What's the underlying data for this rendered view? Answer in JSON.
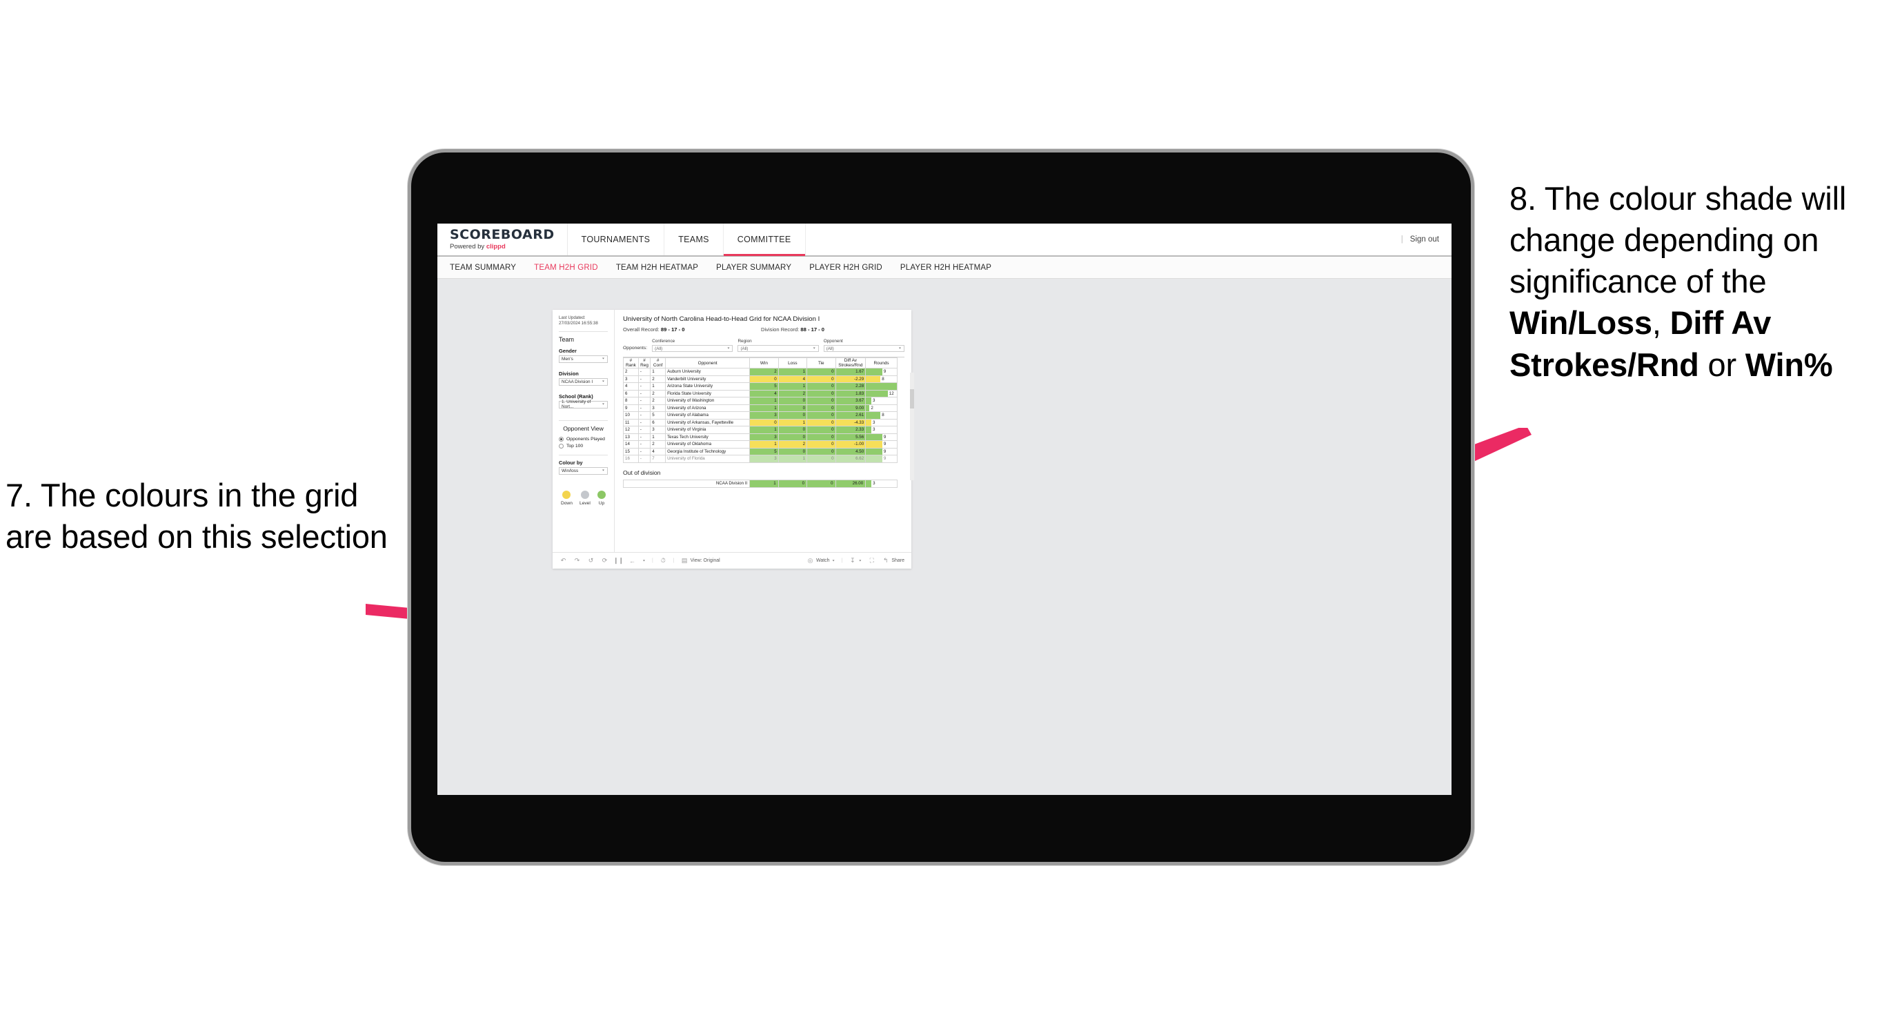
{
  "annotations": {
    "left": {
      "number": "7.",
      "text": "The colours in the grid are based on this selection"
    },
    "right_pre": "8. The colour shade will change depending on significance of the ",
    "right_b1": "Win/Loss",
    "right_mid1": ", ",
    "right_b2": "Diff Av Strokes/Rnd",
    "right_mid2": " or ",
    "right_b3": "Win%"
  },
  "brand": {
    "title": "SCOREBOARD",
    "powered": "Powered by ",
    "company": "clippd"
  },
  "topnav": [
    {
      "label": "TOURNAMENTS",
      "active": false
    },
    {
      "label": "TEAMS",
      "active": false
    },
    {
      "label": "COMMITTEE",
      "active": true
    }
  ],
  "topbar_right": {
    "divider": "|",
    "sign_out": "Sign out"
  },
  "subnav": [
    {
      "label": "TEAM SUMMARY",
      "active": false
    },
    {
      "label": "TEAM H2H GRID",
      "active": true
    },
    {
      "label": "TEAM H2H HEATMAP",
      "active": false
    },
    {
      "label": "PLAYER SUMMARY",
      "active": false
    },
    {
      "label": "PLAYER H2H GRID",
      "active": false
    },
    {
      "label": "PLAYER H2H HEATMAP",
      "active": false
    }
  ],
  "sidebar": {
    "last_updated": "Last Updated: 27/03/2024 16:55:38",
    "team_heading": "Team",
    "gender": {
      "label": "Gender",
      "value": "Men's"
    },
    "division": {
      "label": "Division",
      "value": "NCAA Division I"
    },
    "school": {
      "label": "School (Rank)",
      "value": "1. University of Nort..."
    },
    "opponent_view": {
      "heading": "Opponent View",
      "options": [
        {
          "label": "Opponents Played",
          "selected": true
        },
        {
          "label": "Top 100",
          "selected": false
        }
      ]
    },
    "colour_by": {
      "label": "Colour by",
      "value": "Win/loss"
    },
    "legend": [
      {
        "label": "Down",
        "color": "#f3d44e"
      },
      {
        "label": "Level",
        "color": "#c4c7cc"
      },
      {
        "label": "Up",
        "color": "#8cc765"
      }
    ]
  },
  "viz": {
    "title": "University of North Carolina Head-to-Head Grid for NCAA Division I",
    "overall_label": "Overall Record: ",
    "overall_value": "89 - 17 - 0",
    "division_label": "Division Record: ",
    "division_value": "88 - 17 - 0",
    "opponents_label": "Opponents:",
    "filters": [
      {
        "caption": "Conference",
        "value": "(All)"
      },
      {
        "caption": "Region",
        "value": "(All)"
      },
      {
        "caption": "Opponent",
        "value": "(All)"
      }
    ],
    "columns": [
      "# Rank",
      "# Reg",
      "# Conf",
      "Opponent",
      "Win",
      "Loss",
      "Tie",
      "Diff Av Strokes/Rnd",
      "Rounds"
    ],
    "out_of_division_title": "Out of division"
  },
  "chart_data": {
    "type": "table",
    "title": "University of North Carolina Head-to-Head Grid for NCAA Division I",
    "columns": [
      "# Rank",
      "# Reg",
      "# Conf",
      "Opponent",
      "Win",
      "Loss",
      "Tie",
      "Diff Av Strokes/Rnd",
      "Rounds"
    ],
    "colour_rule": "Win/loss — green = Up, yellow = Down",
    "rounds_max": 17,
    "rows": [
      {
        "rank": "2",
        "reg": "-",
        "conf": "1",
        "opponent": "Auburn University",
        "win": "2",
        "loss": "1",
        "tie": "0",
        "diff": "1.67",
        "rounds": "9",
        "state": "up"
      },
      {
        "rank": "3",
        "reg": "-",
        "conf": "2",
        "opponent": "Vanderbilt University",
        "win": "0",
        "loss": "4",
        "tie": "0",
        "diff": "-2.29",
        "rounds": "8",
        "state": "down"
      },
      {
        "rank": "4",
        "reg": "-",
        "conf": "1",
        "opponent": "Arizona State University",
        "win": "5",
        "loss": "1",
        "tie": "0",
        "diff": "2.28",
        "rounds": "17",
        "state": "up"
      },
      {
        "rank": "6",
        "reg": "-",
        "conf": "2",
        "opponent": "Florida State University",
        "win": "4",
        "loss": "2",
        "tie": "0",
        "diff": "1.83",
        "rounds": "12",
        "state": "up"
      },
      {
        "rank": "8",
        "reg": "-",
        "conf": "2",
        "opponent": "University of Washington",
        "win": "1",
        "loss": "0",
        "tie": "0",
        "diff": "3.67",
        "rounds": "3",
        "state": "up"
      },
      {
        "rank": "9",
        "reg": "-",
        "conf": "3",
        "opponent": "University of Arizona",
        "win": "1",
        "loss": "0",
        "tie": "0",
        "diff": "9.00",
        "rounds": "2",
        "state": "up"
      },
      {
        "rank": "10",
        "reg": "-",
        "conf": "5",
        "opponent": "University of Alabama",
        "win": "3",
        "loss": "0",
        "tie": "0",
        "diff": "2.61",
        "rounds": "8",
        "state": "up"
      },
      {
        "rank": "11",
        "reg": "-",
        "conf": "6",
        "opponent": "University of Arkansas, Fayetteville",
        "win": "0",
        "loss": "1",
        "tie": "0",
        "diff": "-4.33",
        "rounds": "3",
        "state": "down"
      },
      {
        "rank": "12",
        "reg": "-",
        "conf": "3",
        "opponent": "University of Virginia",
        "win": "1",
        "loss": "0",
        "tie": "0",
        "diff": "2.33",
        "rounds": "3",
        "state": "up"
      },
      {
        "rank": "13",
        "reg": "-",
        "conf": "1",
        "opponent": "Texas Tech University",
        "win": "3",
        "loss": "0",
        "tie": "0",
        "diff": "5.56",
        "rounds": "9",
        "state": "up"
      },
      {
        "rank": "14",
        "reg": "-",
        "conf": "2",
        "opponent": "University of Oklahoma",
        "win": "1",
        "loss": "2",
        "tie": "0",
        "diff": "-1.00",
        "rounds": "9",
        "state": "down"
      },
      {
        "rank": "15",
        "reg": "-",
        "conf": "4",
        "opponent": "Georgia Institute of Technology",
        "win": "5",
        "loss": "0",
        "tie": "0",
        "diff": "4.50",
        "rounds": "9",
        "state": "up"
      },
      {
        "rank": "16",
        "reg": "-",
        "conf": "7",
        "opponent": "University of Florida",
        "win": "3",
        "loss": "1",
        "tie": "0",
        "diff": "6.62",
        "rounds": "9",
        "state": "up"
      }
    ],
    "out_of_division": [
      {
        "opponent": "NCAA Division II",
        "win": "1",
        "loss": "0",
        "tie": "0",
        "diff": "26.00",
        "rounds": "3",
        "state": "up"
      }
    ]
  },
  "toolbar": {
    "view_label": "View: Original",
    "watch_label": "Watch",
    "share_label": "Share"
  }
}
